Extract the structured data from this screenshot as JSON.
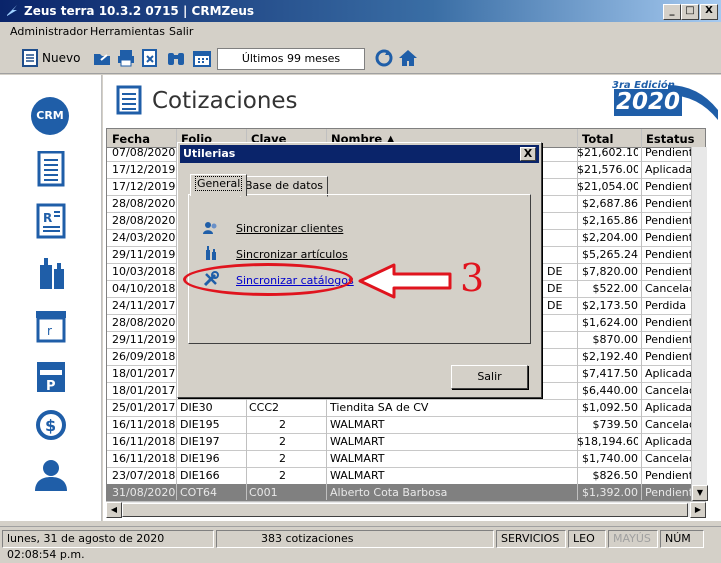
{
  "window": {
    "title": "Zeus terra 10.3.2 0715 | CRMZeus",
    "min": "_",
    "max": "□",
    "close": "X"
  },
  "menu": [
    "Administrador",
    "Herramientas",
    "Salir"
  ],
  "toolbar": {
    "new_label": "Nuevo",
    "period": "Últimos 99 meses"
  },
  "sidebar": {
    "crm_label": "CRM",
    "icons": [
      "crm-icon",
      "document-icon",
      "contacts-icon",
      "bottles-icon",
      "box-icon",
      "calendar-icon",
      "refresh-money-icon",
      "user-icon"
    ]
  },
  "page": {
    "title": "Cotizaciones",
    "badge_top": "3ra Edición",
    "badge_year": "2020"
  },
  "grid": {
    "columns": [
      "Fecha",
      "Folio",
      "Clave",
      "Nombre",
      "Total",
      "Estatus"
    ],
    "rows": [
      {
        "fecha": "07/08/2020",
        "folio": "",
        "clave": "",
        "nombre": "",
        "extra": "",
        "total": "$21,602.10",
        "estatus": "Pendiente"
      },
      {
        "fecha": "17/12/2019",
        "folio": "",
        "clave": "",
        "nombre": "",
        "extra": "",
        "total": "$21,576.00",
        "estatus": "Aplicada"
      },
      {
        "fecha": "17/12/2019",
        "folio": "",
        "clave": "",
        "nombre": "",
        "extra": "",
        "total": "$21,054.00",
        "estatus": "Pendiente"
      },
      {
        "fecha": "28/08/2020",
        "folio": "",
        "clave": "",
        "nombre": "",
        "extra": "",
        "total": "$2,687.86",
        "estatus": "Pendiente"
      },
      {
        "fecha": "28/08/2020",
        "folio": "",
        "clave": "",
        "nombre": "",
        "extra": "",
        "total": "$2,165.86",
        "estatus": "Pendiente"
      },
      {
        "fecha": "24/03/2020",
        "folio": "",
        "clave": "",
        "nombre": "",
        "extra": "",
        "total": "$2,204.00",
        "estatus": "Pendiente"
      },
      {
        "fecha": "29/11/2019",
        "folio": "",
        "clave": "",
        "nombre": "",
        "extra": "",
        "total": "$5,265.24",
        "estatus": "Pendiente"
      },
      {
        "fecha": "10/03/2018",
        "folio": "",
        "clave": "",
        "nombre": "",
        "extra": "DE",
        "total": "$7,820.00",
        "estatus": "Pendiente"
      },
      {
        "fecha": "04/10/2018",
        "folio": "",
        "clave": "",
        "nombre": "",
        "extra": "DE",
        "total": "$522.00",
        "estatus": "Cancelada"
      },
      {
        "fecha": "24/11/2017",
        "folio": "",
        "clave": "",
        "nombre": "",
        "extra": "DE",
        "total": "$2,173.50",
        "estatus": "Perdida"
      },
      {
        "fecha": "28/08/2020",
        "folio": "",
        "clave": "",
        "nombre": "",
        "extra": "",
        "total": "$1,624.00",
        "estatus": "Pendiente"
      },
      {
        "fecha": "29/11/2019",
        "folio": "",
        "clave": "",
        "nombre": "",
        "extra": "",
        "total": "$870.00",
        "estatus": "Pendiente"
      },
      {
        "fecha": "26/09/2018",
        "folio": "",
        "clave": "",
        "nombre": "",
        "extra": "",
        "total": "$2,192.40",
        "estatus": "Pendiente"
      },
      {
        "fecha": "18/01/2017",
        "folio": "",
        "clave": "",
        "nombre": "",
        "extra": "",
        "total": "$7,417.50",
        "estatus": "Aplicada"
      },
      {
        "fecha": "18/01/2017",
        "folio": "",
        "clave": "",
        "nombre": "",
        "extra": "",
        "total": "$6,440.00",
        "estatus": "Cancelada"
      },
      {
        "fecha": "25/01/2017",
        "folio": "DIE30",
        "clave": "CCC2",
        "nombre": "Tiendita SA de CV",
        "extra": "",
        "total": "$1,092.50",
        "estatus": "Aplicada"
      },
      {
        "fecha": "16/11/2018",
        "folio": "DIE195",
        "clave": "2",
        "nombre": "WALMART",
        "extra": "",
        "total": "$739.50",
        "estatus": "Cancelada"
      },
      {
        "fecha": "16/11/2018",
        "folio": "DIE197",
        "clave": "2",
        "nombre": "WALMART",
        "extra": "",
        "total": "$18,194.60",
        "estatus": "Aplicada"
      },
      {
        "fecha": "16/11/2018",
        "folio": "DIE196",
        "clave": "2",
        "nombre": "WALMART",
        "extra": "",
        "total": "$1,740.00",
        "estatus": "Cancelada"
      },
      {
        "fecha": "23/07/2018",
        "folio": "DIE166",
        "clave": "2",
        "nombre": "WALMART",
        "extra": "",
        "total": "$826.50",
        "estatus": "Pendiente"
      },
      {
        "fecha": "31/08/2020",
        "folio": "COT64",
        "clave": "C001",
        "nombre": "Alberto Cota Barbosa",
        "extra": "",
        "total": "$1,392.00",
        "estatus": "Pendiente",
        "selected": true
      }
    ]
  },
  "dialog": {
    "title": "Utilerias",
    "close": "X",
    "tabs": [
      "General",
      "Base de datos"
    ],
    "links": [
      "Sincronizar clientes",
      "Sincronizar artículos",
      "Sincronizar catálogos"
    ],
    "exit_label": "Salir"
  },
  "annotation": {
    "number": "3",
    "color": "#e0141e"
  },
  "status": {
    "datetime": "lunes, 31 de agosto de 2020 02:08:54 p.m.",
    "count": "383 cotizaciones",
    "servicios": "SERVICIOS",
    "leo": "LEO",
    "mayus": "MAYÚS",
    "num": "NÚM"
  },
  "colors": {
    "accent": "#1f5ea8",
    "selected_row": "#808080",
    "titlebar": "#0a246a"
  }
}
